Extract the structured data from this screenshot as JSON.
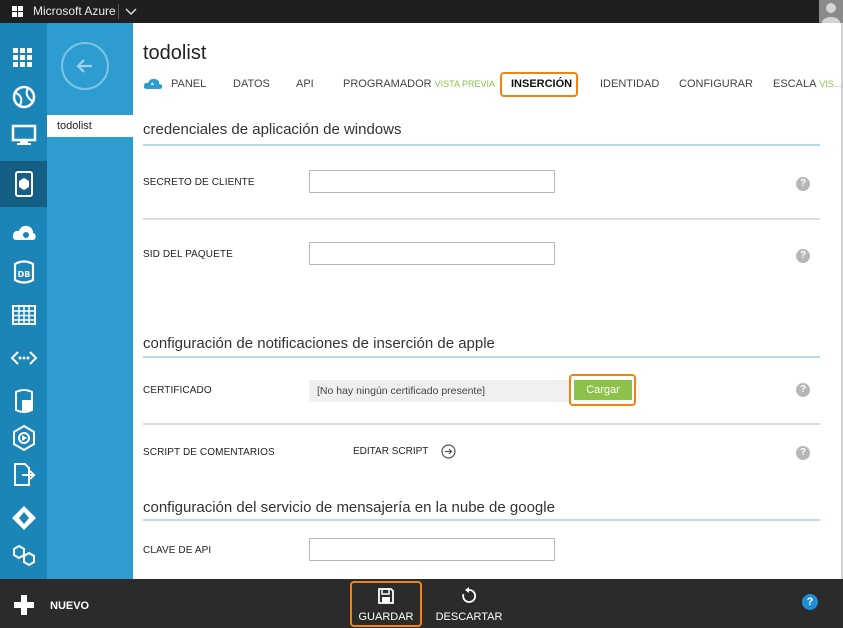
{
  "topbar": {
    "brand": "Microsoft Azure"
  },
  "sidebar": {
    "current_item": "todolist"
  },
  "page": {
    "title": "todolist"
  },
  "tabs": [
    {
      "label": "PANEL"
    },
    {
      "label": "DATOS"
    },
    {
      "label": "API"
    },
    {
      "label": "PROGRAMADOR",
      "badge": "VISTA PREVIA"
    },
    {
      "label": "INSERCIÓN"
    },
    {
      "label": "IDENTIDAD"
    },
    {
      "label": "CONFIGURAR"
    },
    {
      "label": "ESCALA",
      "badge": "VIS..."
    }
  ],
  "windows": {
    "section_title": "credenciales de aplicación de windows",
    "client_secret_label": "SECRETO DE CLIENTE",
    "client_secret_value": "",
    "package_sid_label": "SID DEL PAQUETE",
    "package_sid_value": ""
  },
  "apple": {
    "section_title": "configuración de notificaciones de inserción de apple",
    "certificate_label": "CERTIFICADO",
    "certificate_value": "[No hay ningún certificado presente]",
    "upload_label": "Cargar",
    "feedback_script_label": "SCRIPT DE COMENTARIOS",
    "edit_script_label": "EDITAR SCRIPT"
  },
  "google": {
    "section_title": "configuración del servicio de mensajería en la nube de google",
    "api_key_label": "CLAVE DE API",
    "api_key_value": ""
  },
  "help_glyph": "?",
  "bottombar": {
    "new_label": "NUEVO",
    "save_label": "GUARDAR",
    "discard_label": "DESCARTAR",
    "help_glyph": "?"
  },
  "colors": {
    "rail": "#1c85b8",
    "rail_active": "#155f85",
    "column": "#2c9cd1",
    "highlight": "#f0850d",
    "upload": "#8cc24a"
  }
}
